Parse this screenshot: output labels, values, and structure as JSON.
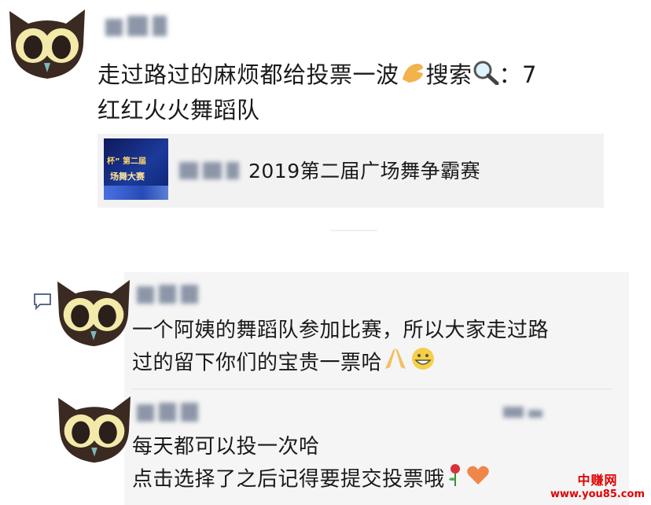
{
  "post": {
    "line1": "走过路过的麻烦都给投票一波",
    "line1b": "搜索",
    "line1c": "：7",
    "line2": "红红火火舞蹈队"
  },
  "link_card": {
    "title": "2019第二届广场舞争霸赛",
    "thumb_text1": "杯” 第二届",
    "thumb_text2": "场舞大赛"
  },
  "comments": [
    {
      "line1": "一个阿姨的舞蹈队参加比赛，所以大家走过路",
      "line2": "过的留下你们的宝贵一票哈"
    },
    {
      "line1": "每天都可以投一次哈",
      "line2": "点击选择了之后记得要提交投票哦"
    }
  ],
  "watermark": {
    "brand": "中赚网",
    "url": "www.you85.com"
  },
  "icons": [
    "owl-avatar-icon",
    "raised-hand-emoji-icon",
    "magnifier-emoji-icon",
    "folded-hands-emoji-icon",
    "grin-face-emoji-icon",
    "rose-emoji-icon",
    "heart-emoji-icon",
    "comment-bubble-icon"
  ]
}
